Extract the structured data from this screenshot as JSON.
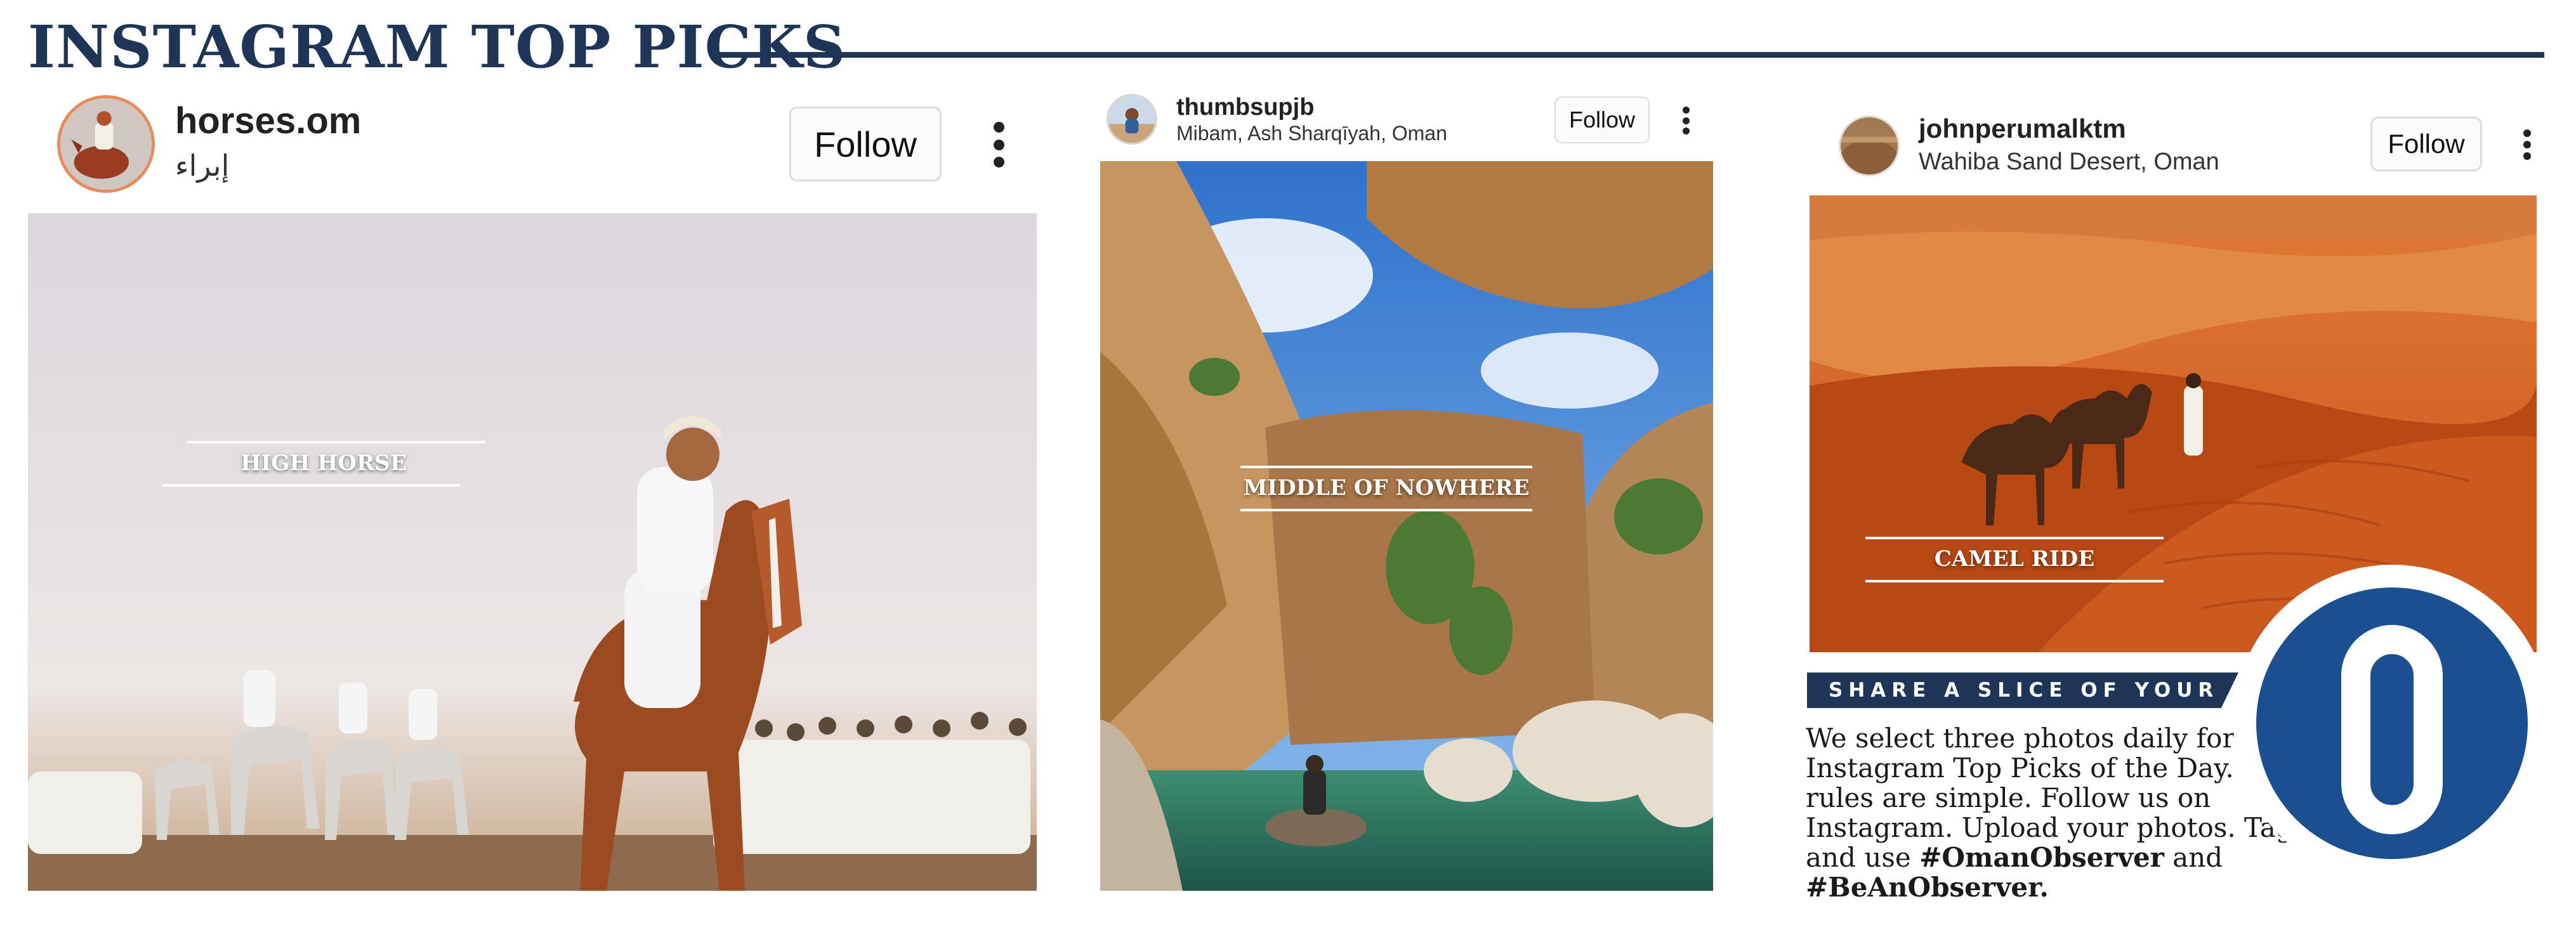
{
  "header": {
    "title": "INSTAGRAM TOP PICKS"
  },
  "posts": [
    {
      "username": "horses.om",
      "subtext": "إبراء",
      "follow_label": "Follow",
      "caption": "HIGH HORSE"
    },
    {
      "username": "thumbsupjb",
      "subtext": "Mibam, Ash Sharqīyah, Oman",
      "follow_label": "Follow",
      "caption": "MIDDLE OF NOWHERE"
    },
    {
      "username": "johnperumalktm",
      "subtext": "Wahiba Sand Desert, Oman",
      "follow_label": "Follow",
      "caption": "CAMEL RIDE"
    }
  ],
  "promo": {
    "banner": "SHARE A SLICE OF YOUR LIFE",
    "text": "We select three photos daily for our Instagram Top Picks of the Day. The rules are simple. Follow us on Instagram. Upload your photos. Tag us and use",
    "hashtag_1": "#OmanObserver",
    "joiner": " and ",
    "hashtag_2": "#BeAnObserver."
  },
  "colors": {
    "navy": "#1f3558",
    "logo_blue": "#1a4f91",
    "desert_orange": "#d9651f",
    "sky_blue": "#3a86d8"
  },
  "icons": {
    "more": "more-vertical-icon",
    "logo": "observer-logo-icon"
  }
}
